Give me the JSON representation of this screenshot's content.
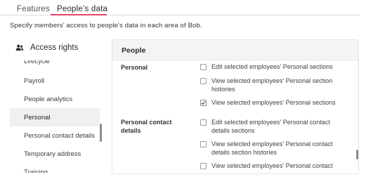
{
  "tabs": [
    {
      "label": "Features"
    },
    {
      "label": "People’s data"
    }
  ],
  "subtitle": "Specify members’ access to people’s data in each area of Bob.",
  "sidebar": {
    "title": "Access rights",
    "icon": "people-icon",
    "items": [
      {
        "label": "Lifecycle"
      },
      {
        "label": "Payroll"
      },
      {
        "label": "People analytics"
      },
      {
        "label": "Personal",
        "active": true
      },
      {
        "label": "Personal contact details"
      },
      {
        "label": "Temporary address"
      },
      {
        "label": "Training"
      }
    ]
  },
  "panel": {
    "title": "People",
    "sections": [
      {
        "label": "Personal",
        "permissions": [
          {
            "text": "Edit selected employees' Personal sections",
            "checked": false
          },
          {
            "text": "View selected employees' Personal section histories",
            "checked": false
          },
          {
            "text": "View selected employees' Personal sections",
            "checked": true
          }
        ]
      },
      {
        "label": "Personal contact details",
        "permissions": [
          {
            "text": "Edit selected employees' Personal contact details sections",
            "checked": false
          },
          {
            "text": "View selected employees' Personal contact details section histories",
            "checked": false
          },
          {
            "text": "View selected employees' Personal contact",
            "checked": false
          }
        ]
      }
    ]
  },
  "colors": {
    "accent": "#e2456b",
    "panel_header_bg": "#f4f4f4",
    "active_item_bg": "#f0f0f0"
  }
}
